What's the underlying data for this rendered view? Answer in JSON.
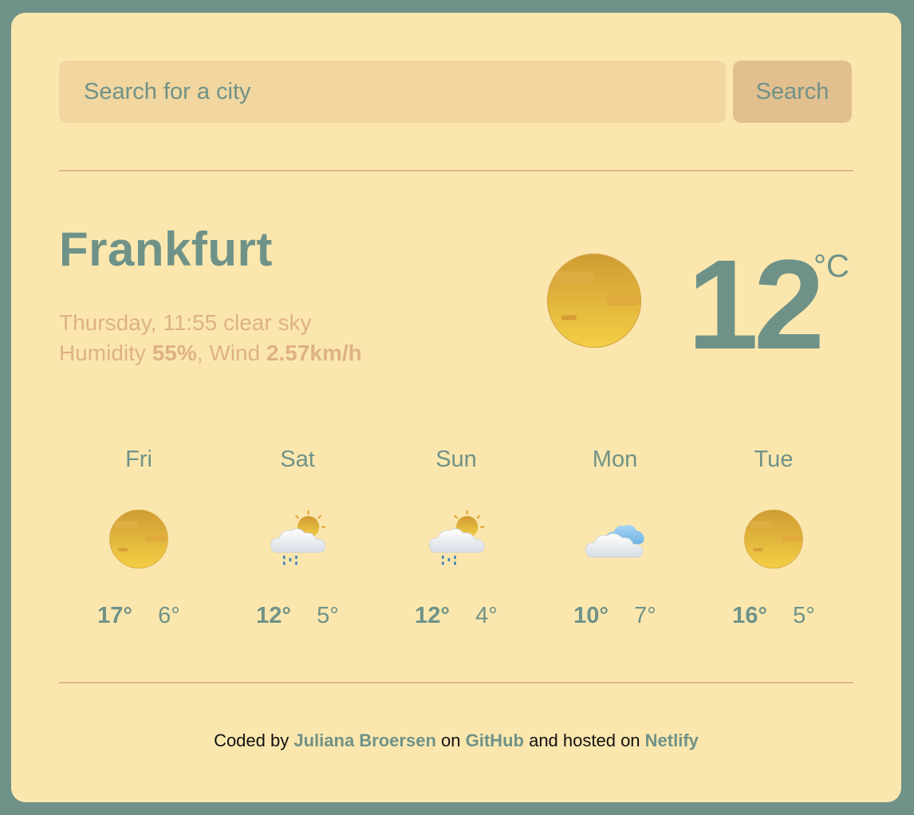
{
  "search": {
    "placeholder": "Search for a city",
    "button_label": "Search"
  },
  "current": {
    "city": "Frankfurt",
    "day_time": "Thursday, 11:55",
    "description": "clear sky",
    "humidity_label": "Humidity",
    "humidity_value": "55%",
    "wind_label": "Wind",
    "wind_value": "2.57km/h",
    "temperature": "12",
    "unit": "°C",
    "icon": "clear-sky-icon"
  },
  "forecast": [
    {
      "day": "Fri",
      "max": "17°",
      "min": "6°",
      "icon": "clear-sky-icon"
    },
    {
      "day": "Sat",
      "max": "12°",
      "min": "5°",
      "icon": "rain-sun-icon"
    },
    {
      "day": "Sun",
      "max": "12°",
      "min": "4°",
      "icon": "rain-sun-icon"
    },
    {
      "day": "Mon",
      "max": "10°",
      "min": "7°",
      "icon": "clouds-icon"
    },
    {
      "day": "Tue",
      "max": "16°",
      "min": "5°",
      "icon": "clear-sky-icon"
    }
  ],
  "footer": {
    "coded_by": "Coded by",
    "author": "Juliana Broersen",
    "on": "on",
    "github": "GitHub",
    "hosted_on": "and hosted on",
    "netlify": "Netlify"
  },
  "colors": {
    "background": "#6f9288",
    "card": "#fbe7ae",
    "accent": "#6f9288",
    "muted": "#deb186"
  }
}
